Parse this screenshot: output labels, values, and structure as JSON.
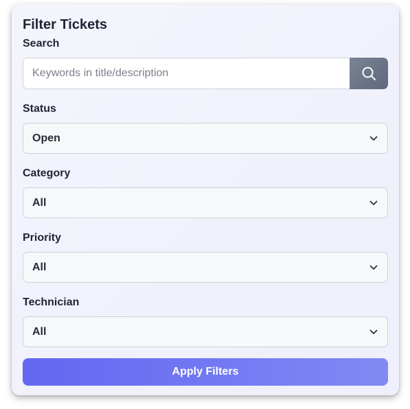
{
  "panel": {
    "title": "Filter Tickets"
  },
  "search": {
    "label": "Search",
    "placeholder": "Keywords in title/description",
    "value": "",
    "button_icon": "search-icon"
  },
  "filters": {
    "status": {
      "label": "Status",
      "value": "Open"
    },
    "category": {
      "label": "Category",
      "value": "All"
    },
    "priority": {
      "label": "Priority",
      "value": "All"
    },
    "technician": {
      "label": "Technician",
      "value": "All"
    }
  },
  "actions": {
    "apply_label": "Apply Filters"
  },
  "colors": {
    "accent_start": "#6366f1",
    "accent_end": "#8189f4",
    "search_button": "#6b7387"
  }
}
